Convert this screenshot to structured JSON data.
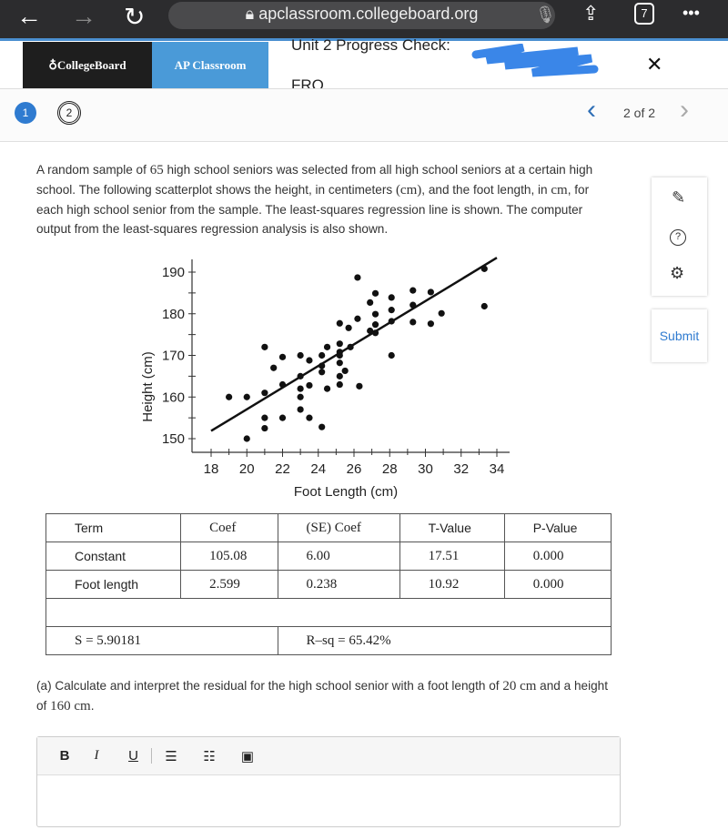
{
  "browser": {
    "url": "apclassroom.collegeboard.org",
    "tab_count": "7",
    "back": "←",
    "forward": "→",
    "reload": "↻",
    "more": "•••"
  },
  "header": {
    "logo": "CollegeBoard",
    "app": "AP Classroom",
    "title_line1": "Unit 2 Progress Check:",
    "title_line2": "FRQ",
    "close": "✕"
  },
  "nav": {
    "questions": [
      "1",
      "2"
    ],
    "position": "2 of 2",
    "prev": "‹",
    "next": "›"
  },
  "prompt": {
    "p1": "A random sample of ",
    "n": "65",
    "p2": " high school seniors was selected from all high school seniors at a certain high school. The following scatterplot shows the height, in centimeters ",
    "cm_paren": "(cm)",
    "p3": ", and the foot length, in ",
    "cm": "cm",
    "p4": ", for each high school senior from the sample. The least-squares regression line is shown. The computer output from the least-squares regression analysis is also shown."
  },
  "tools": {
    "submit": "Submit"
  },
  "chart_data": {
    "type": "scatter",
    "xlabel": "Foot Length (cm)",
    "ylabel": "Height (cm)",
    "xlim": [
      17,
      35
    ],
    "ylim": [
      148,
      195
    ],
    "xticks": [
      18,
      20,
      22,
      24,
      26,
      28,
      30,
      32,
      34
    ],
    "yticks": [
      150,
      160,
      170,
      180,
      190
    ],
    "regression_line": {
      "intercept": 105.08,
      "slope": 2.599,
      "x_range": [
        18,
        34
      ]
    },
    "points": [
      [
        19,
        160
      ],
      [
        20,
        160
      ],
      [
        20,
        150
      ],
      [
        21,
        172
      ],
      [
        21,
        161
      ],
      [
        21,
        155
      ],
      [
        21,
        152.5
      ],
      [
        21.5,
        167
      ],
      [
        22,
        169.6
      ],
      [
        22,
        163
      ],
      [
        22,
        155
      ],
      [
        23,
        170
      ],
      [
        23,
        165
      ],
      [
        23,
        162
      ],
      [
        23,
        160
      ],
      [
        23,
        157
      ],
      [
        23.5,
        168.8
      ],
      [
        23.5,
        162.8
      ],
      [
        23.5,
        155
      ],
      [
        24.2,
        170
      ],
      [
        24.2,
        167.5
      ],
      [
        24.2,
        166
      ],
      [
        24.2,
        152.8
      ],
      [
        24.5,
        172
      ],
      [
        24.5,
        162
      ],
      [
        25.2,
        177.7
      ],
      [
        25.2,
        172.8
      ],
      [
        25.2,
        170.8
      ],
      [
        25.2,
        170
      ],
      [
        25.2,
        168.2
      ],
      [
        25.2,
        165
      ],
      [
        25.2,
        163
      ],
      [
        25.5,
        166.3
      ],
      [
        25.7,
        176.6
      ],
      [
        25.8,
        172
      ],
      [
        26.2,
        188.7
      ],
      [
        26.2,
        178.8
      ],
      [
        26.3,
        162.6
      ],
      [
        26.9,
        182.7
      ],
      [
        26.9,
        175.9
      ],
      [
        27.2,
        184.9
      ],
      [
        27.2,
        179.9
      ],
      [
        27.2,
        177.4
      ],
      [
        27.2,
        175.4
      ],
      [
        28.1,
        183.9
      ],
      [
        28.1,
        180.9
      ],
      [
        28.1,
        178.2
      ],
      [
        28.1,
        170
      ],
      [
        29.3,
        185.6
      ],
      [
        29.3,
        182.1
      ],
      [
        29.3,
        178
      ],
      [
        30.3,
        185.2
      ],
      [
        30.3,
        177.6
      ],
      [
        30.9,
        180.1
      ],
      [
        33.3,
        190.8
      ],
      [
        33.3,
        181.8
      ]
    ]
  },
  "table": {
    "headers": [
      "Term",
      "Coef",
      "(SE) Coef",
      "T-Value",
      "P-Value"
    ],
    "rows": [
      [
        "Constant",
        "105.08",
        "6.00",
        "17.51",
        "0.000"
      ],
      [
        "Foot length",
        "2.599",
        "0.238",
        "10.92",
        "0.000"
      ]
    ],
    "s": "S = 5.90181",
    "rsq": "R–sq = 65.42%"
  },
  "question": {
    "a1": "(a) Calculate and interpret the residual for the high school senior with a foot length of ",
    "v1": "20 cm",
    "a2": " and a height of ",
    "v2": "160 cm",
    "a3": "."
  },
  "editor": {
    "bold": "B",
    "italic": "I",
    "underline": "U",
    "bullets": "☰",
    "numbered": "☷",
    "image": "▣"
  }
}
